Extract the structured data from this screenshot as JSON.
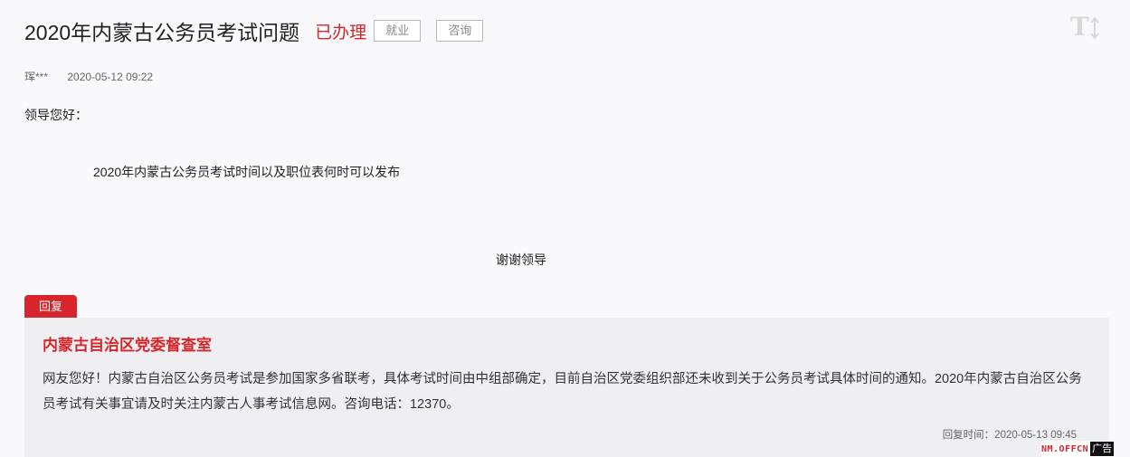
{
  "header": {
    "title": "2020年内蒙古公务员考试问题",
    "status": "已办理",
    "tags": [
      "就业",
      "咨询"
    ],
    "font_size_toggle_label": "T"
  },
  "question": {
    "author": "珲***",
    "date": "2020-05-12 09:22",
    "greeting": "领导您好：",
    "body": "2020年内蒙古公务员考试时间以及职位表何时可以发布",
    "closing": "谢谢领导"
  },
  "reply": {
    "badge": "回复",
    "org": "内蒙古自治区党委督查室",
    "text": "网友您好！内蒙古自治区公务员考试是参加国家多省联考，具体考试时间由中组部确定，目前自治区党委组织部还未收到关于公务员考试具体时间的通知。2020年内蒙古自治区公务员考试有关事宜请及时关注内蒙古人事考试信息网。咨询电话：12370。",
    "time": "回复时间：2020-05-13 09:45"
  },
  "ad": {
    "site": "NM.OFFCN",
    "label": "广告"
  },
  "colors": {
    "accent": "#d7262b",
    "reply_bg": "#eeeef3",
    "page_bg": "#f9f9fb"
  },
  "icons": {
    "font_toggle": "font-size-toggle-icon"
  }
}
